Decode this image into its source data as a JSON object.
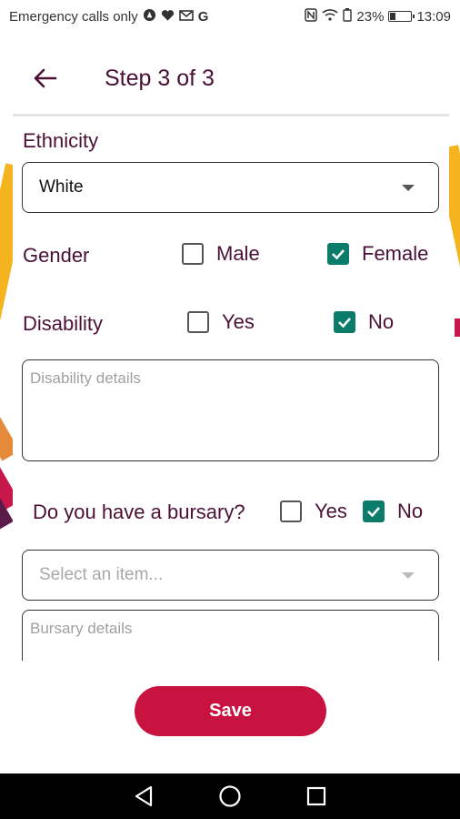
{
  "status_bar": {
    "carrier": "Emergency calls only",
    "battery": "23%",
    "battery_level": 0.23,
    "time": "13:09",
    "icons_left": [
      "alert-circle-icon",
      "heart-icon",
      "mail-icon",
      "google-icon"
    ],
    "icons_right": [
      "nfc-icon",
      "wifi-icon",
      "battery-saver-icon",
      "battery-icon"
    ]
  },
  "header": {
    "title": "Step 3 of 3",
    "back_icon": "arrow-left-icon"
  },
  "form": {
    "ethnicity": {
      "label": "Ethnicity",
      "value": "White"
    },
    "gender": {
      "label": "Gender",
      "options": [
        {
          "label": "Male",
          "checked": false
        },
        {
          "label": "Female",
          "checked": true
        }
      ]
    },
    "disability": {
      "label": "Disability",
      "options": [
        {
          "label": "Yes",
          "checked": false
        },
        {
          "label": "No",
          "checked": true
        }
      ],
      "details_placeholder": "Disability details"
    },
    "bursary": {
      "label": "Do you have a bursary?",
      "options": [
        {
          "label": "Yes",
          "checked": false
        },
        {
          "label": "No",
          "checked": true
        }
      ],
      "select_placeholder": "Select an item...",
      "details_placeholder": "Bursary details"
    }
  },
  "actions": {
    "save_label": "Save"
  },
  "colors": {
    "brand_primary": "#c8123f",
    "title_text": "#4a1036",
    "checkbox_checked": "#0b7b6b"
  },
  "nav": {
    "back_icon": "triangle-back-icon",
    "home_icon": "circle-home-icon",
    "recents_icon": "square-recents-icon"
  }
}
